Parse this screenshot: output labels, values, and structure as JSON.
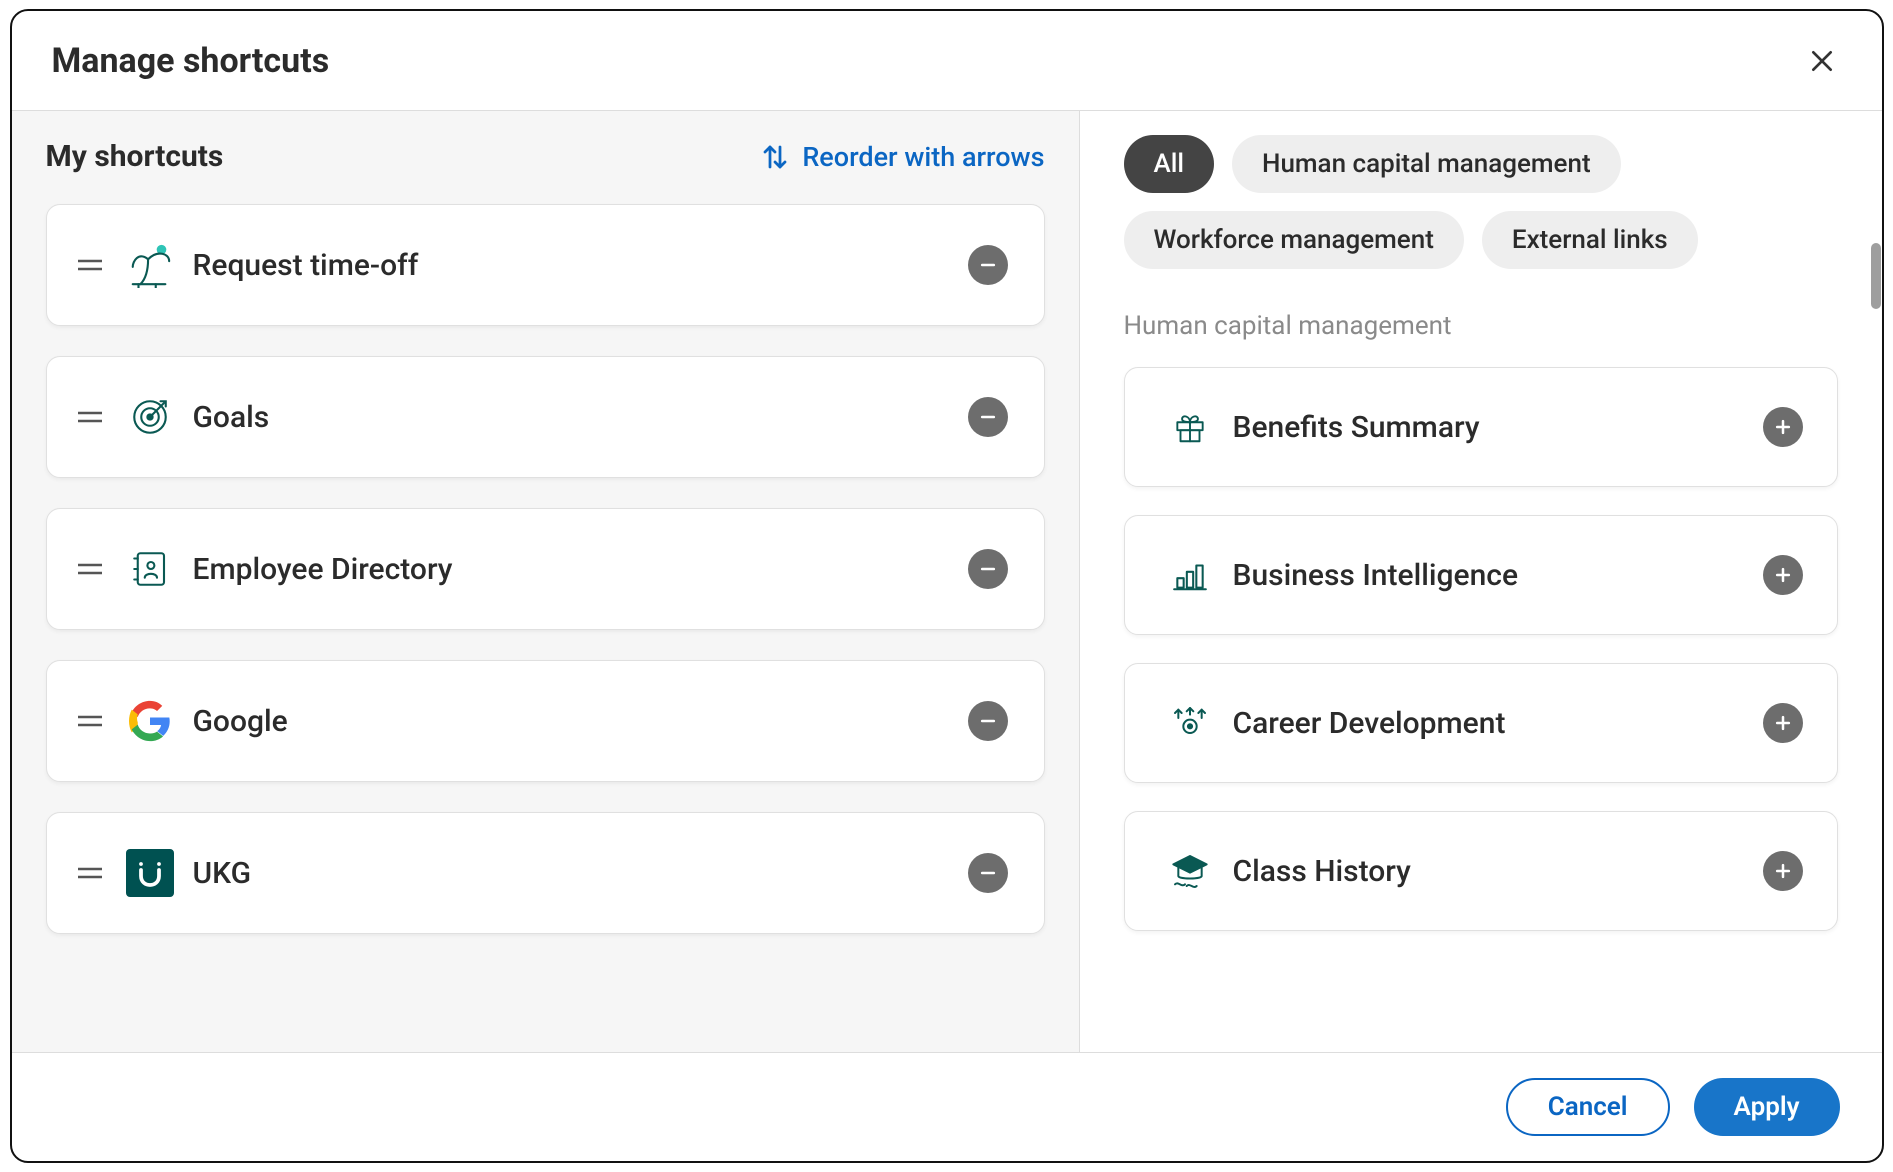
{
  "dialog": {
    "title": "Manage shortcuts"
  },
  "left": {
    "title": "My shortcuts",
    "reorder_label": "Reorder with arrows",
    "shortcuts": [
      {
        "label": "Request time-off",
        "icon": "palm"
      },
      {
        "label": "Goals",
        "icon": "target"
      },
      {
        "label": "Employee Directory",
        "icon": "directory"
      },
      {
        "label": "Google",
        "icon": "google"
      },
      {
        "label": "UKG",
        "icon": "ukg"
      }
    ]
  },
  "right": {
    "filters": [
      {
        "label": "All",
        "active": true
      },
      {
        "label": "Human capital management",
        "active": false
      },
      {
        "label": "Workforce management",
        "active": false
      },
      {
        "label": "External links",
        "active": false
      }
    ],
    "section_label": "Human capital management",
    "available": [
      {
        "label": "Benefits Summary",
        "icon": "gift"
      },
      {
        "label": "Business Intelligence",
        "icon": "bars"
      },
      {
        "label": "Career Development",
        "icon": "career"
      },
      {
        "label": "Class History",
        "icon": "gradcap"
      }
    ]
  },
  "footer": {
    "cancel": "Cancel",
    "apply": "Apply"
  }
}
